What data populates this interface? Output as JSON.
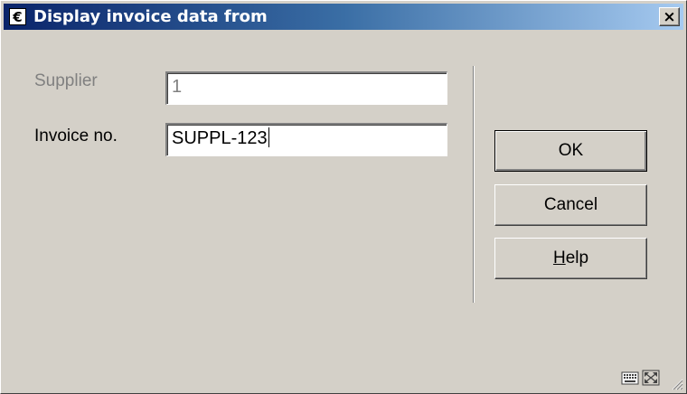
{
  "window": {
    "title": "Display invoice data from",
    "app_icon_glyph": "€",
    "close_glyph": "×"
  },
  "form": {
    "supplier_label": "Supplier",
    "supplier_value": "1",
    "invoice_label": "Invoice no.",
    "invoice_value": "SUPPL-123"
  },
  "buttons": {
    "ok_label": "OK",
    "cancel_label": "Cancel",
    "help_mnemonic": "H",
    "help_rest": "elp"
  },
  "status_bar": {
    "icons": [
      "keyboard-icon",
      "resize-icon"
    ]
  },
  "colors": {
    "dialog_bg": "#d4d0c8",
    "titlebar_start": "#0a246a",
    "titlebar_end": "#a6caf0",
    "disabled_text": "#808080"
  }
}
